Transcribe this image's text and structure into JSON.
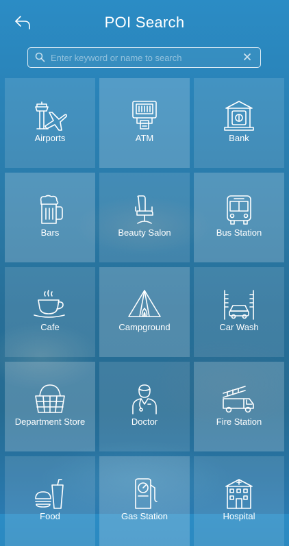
{
  "header": {
    "title": "POI Search",
    "back_icon": "back-arrow-icon"
  },
  "search": {
    "placeholder": "Enter keyword or name to search",
    "value": "",
    "search_icon": "magnifier-icon",
    "clear_icon": "close-icon"
  },
  "categories": [
    {
      "label": "Airports",
      "icon": "airport-icon"
    },
    {
      "label": "ATM",
      "icon": "atm-icon"
    },
    {
      "label": "Bank",
      "icon": "bank-icon"
    },
    {
      "label": "Bars",
      "icon": "beer-mug-icon"
    },
    {
      "label": "Beauty Salon",
      "icon": "salon-chair-icon"
    },
    {
      "label": "Bus Station",
      "icon": "bus-icon"
    },
    {
      "label": "Cafe",
      "icon": "coffee-cup-icon"
    },
    {
      "label": "Campground",
      "icon": "tent-icon"
    },
    {
      "label": "Car Wash",
      "icon": "car-wash-icon"
    },
    {
      "label": "Department Store",
      "icon": "shopping-basket-icon"
    },
    {
      "label": "Doctor",
      "icon": "doctor-icon"
    },
    {
      "label": "Fire Station",
      "icon": "fire-truck-icon"
    },
    {
      "label": "Food",
      "icon": "fast-food-icon"
    },
    {
      "label": "Gas Station",
      "icon": "fuel-pump-icon"
    },
    {
      "label": "Hospital",
      "icon": "hospital-icon"
    }
  ],
  "colors": {
    "background_top": "#2b8cc5",
    "background_bottom": "#256b92",
    "text": "#ffffff"
  }
}
